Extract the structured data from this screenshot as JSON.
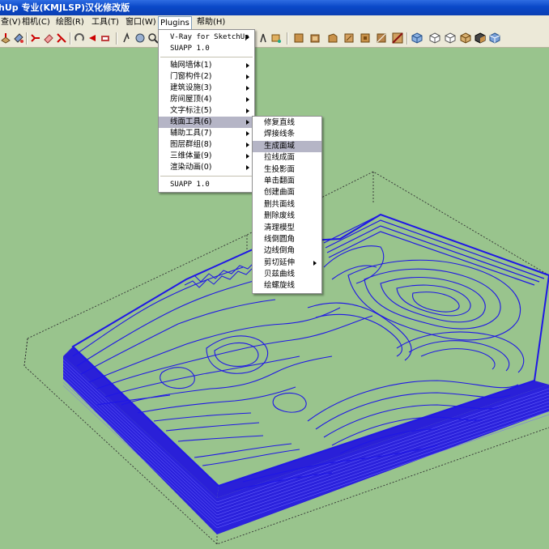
{
  "window": {
    "title": "hUp 专业(KMJLSP)汉化修改版"
  },
  "menubar": {
    "items": [
      {
        "label": "查(V)"
      },
      {
        "label": "相机(C)"
      },
      {
        "label": "绘图(R)"
      },
      {
        "label": "工具(T)"
      },
      {
        "label": "窗口(W)"
      },
      {
        "label": "Plugins"
      },
      {
        "label": "帮助(H)"
      }
    ]
  },
  "plugins_menu": {
    "top_items": [
      "V-Ray for SketchUp",
      "SUAPP 1.0"
    ],
    "items": [
      {
        "label": "轴网墙体(1)"
      },
      {
        "label": "门窗构件(2)"
      },
      {
        "label": "建筑设施(3)"
      },
      {
        "label": "房间屋顶(4)"
      },
      {
        "label": "文字标注(5)"
      },
      {
        "label": "线面工具(6)"
      },
      {
        "label": "辅助工具(7)"
      },
      {
        "label": "图层群组(8)"
      },
      {
        "label": "三维体量(9)"
      },
      {
        "label": "渲染动画(0)"
      }
    ],
    "bottom_item": "SUAPP 1.0",
    "highlighted": "线面工具(6)"
  },
  "line_tools_submenu": {
    "items": [
      {
        "label": "修复直线"
      },
      {
        "label": "焊接线条"
      },
      {
        "label": "生成面域"
      },
      {
        "label": "拉线成面"
      },
      {
        "label": "生投影面"
      },
      {
        "label": "单击翻面"
      },
      {
        "label": "创建曲面"
      },
      {
        "label": "删共面线"
      },
      {
        "label": "删除废线"
      },
      {
        "label": "清理模型"
      },
      {
        "label": "线倒圆角"
      },
      {
        "label": "边线倒角"
      },
      {
        "label": "剪切延伸"
      },
      {
        "label": "贝兹曲线"
      },
      {
        "label": "绘螺旋线"
      }
    ],
    "highlighted": "生成面域"
  },
  "toolbar": {
    "icons": [
      "push-pull-icon",
      "paint-icon",
      "move-icon",
      "eraser-icon",
      "tape-icon",
      "rotate-icon",
      "follow-icon",
      "offset-icon",
      "pan-icon",
      "orbit-icon",
      "zoom-icon",
      "zoom-window-icon",
      "zoom-extents-icon",
      "previous-view-icon",
      "next-view-icon",
      "walk-icon",
      "look-icon",
      "position-camera-icon",
      "section-icon",
      "top-view-icon",
      "front-view-icon",
      "right-view-icon",
      "back-view-icon",
      "left-view-icon",
      "iso-view-icon",
      "xray-icon",
      "wireframe-icon",
      "hidden-line-icon",
      "shaded-icon",
      "textured-icon",
      "monochrome-icon"
    ]
  },
  "colors": {
    "canvas": "#99c48d",
    "contour": "#1f17e6",
    "menu_bg": "#ece9d8",
    "highlight": "#b5b5c6"
  }
}
